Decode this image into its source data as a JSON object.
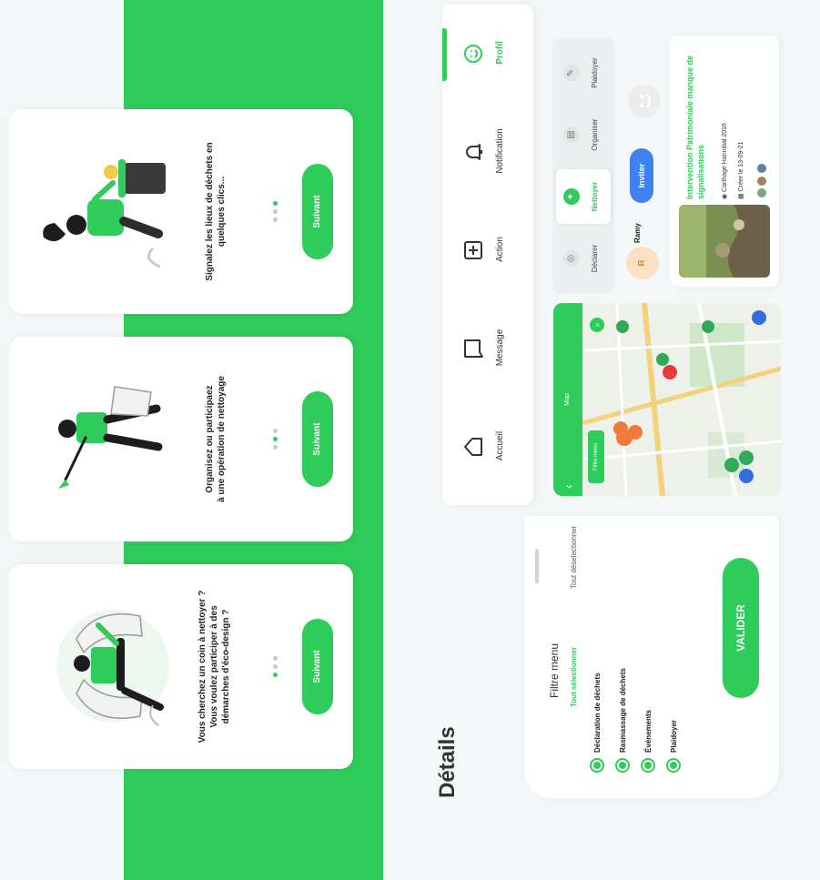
{
  "onboarding": {
    "cards": [
      {
        "caption_lines": [
          "Vous cherchez un coin à nettoyer ?",
          "Vous voulez participer à des",
          "démarches d'éco-design ?"
        ],
        "button": "Suivant"
      },
      {
        "caption_lines": [
          "Organisez ou participaez",
          "à une opération de nettoyage"
        ],
        "button": "Suivant"
      },
      {
        "caption_lines": [
          "Signalez les lieux de déchets en",
          "quelques clics..."
        ],
        "button": "Suivant"
      }
    ]
  },
  "details": {
    "title": "Détails",
    "filter_menu": {
      "title": "Filtre menu",
      "select_all": "Tout sélectionner",
      "deselect_all": "Tout déselectionner",
      "options": [
        "Déclaration de déchets",
        "Rasmassage de déchets",
        "Événements",
        "Plaidoyer"
      ],
      "validate": "VALIDER"
    }
  },
  "nav": {
    "items": [
      {
        "label": "Accueil",
        "icon": "home-icon"
      },
      {
        "label": "Message",
        "icon": "message-icon"
      },
      {
        "label": "Action",
        "icon": "plus-square-icon"
      },
      {
        "label": "Notification",
        "icon": "bell-icon"
      },
      {
        "label": "Profil",
        "icon": "smile-icon"
      }
    ],
    "active": "Profil"
  },
  "map": {
    "title": "Map",
    "filter_chip": "Filtre menu",
    "back": "‹",
    "search": "⌕"
  },
  "actions": {
    "items": [
      {
        "label": "Déclarer",
        "icon": "declare-icon"
      },
      {
        "label": "Nettoyer",
        "icon": "broom-icon"
      },
      {
        "label": "Organiser",
        "icon": "organise-icon"
      },
      {
        "label": "Plaidoyer",
        "icon": "megaphone-icon"
      }
    ],
    "selected": "Nettoyer"
  },
  "invite": {
    "avatar_initial": "R",
    "name": "Ramy",
    "button": "Inviter"
  },
  "event": {
    "title": "Intervention Patrimoniale manque de signalisations",
    "location": "Carthage Hannibal 2016",
    "date": "Créer le 13-09-21"
  },
  "colors": {
    "brand_green": "#2ecc5a",
    "invite_blue": "#3d82f0",
    "pin_orange": "#f07a3a",
    "pin_red": "#e63b3b",
    "pin_green": "#2eaa5a",
    "pin_blue": "#2f6fe0"
  }
}
